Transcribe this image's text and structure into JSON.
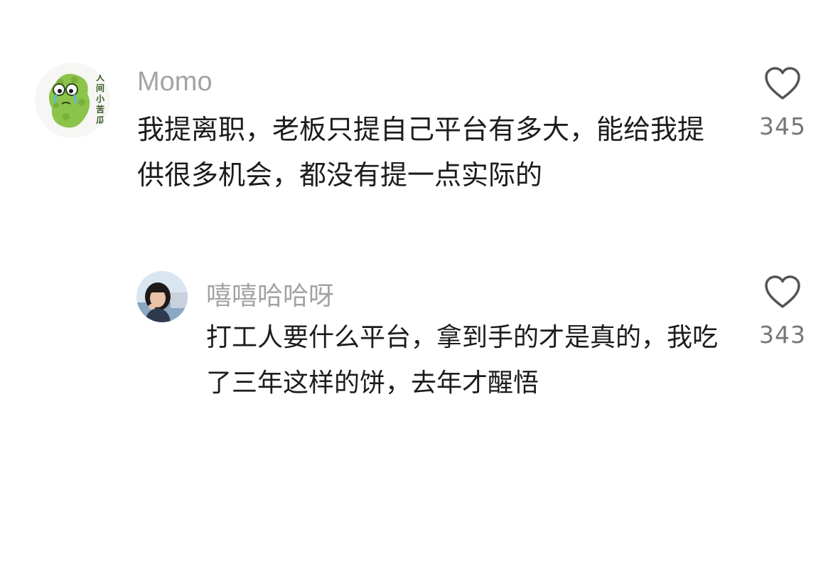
{
  "comments": [
    {
      "username": "Momo",
      "text": "我提离职，老板只提自己平台有多大，能给我提供很多机会，都没有提一点实际的",
      "likes": "345",
      "avatar_text": "人间小苦瓜",
      "avatar_icon": "bitter-melon-cartoon-avatar"
    },
    {
      "username": "嘻嘻哈哈呀",
      "text": "打工人要什么平台，拿到手的才是真的，我吃了三年这样的饼，去年才醒悟",
      "likes": "343",
      "avatar_icon": "person-photo-avatar"
    }
  ],
  "colors": {
    "username": "#a3a3a3",
    "text": "#1c1c1c",
    "like_count": "#777777",
    "heart_outline": "#555555",
    "avatar_green": "#8cc34a"
  }
}
